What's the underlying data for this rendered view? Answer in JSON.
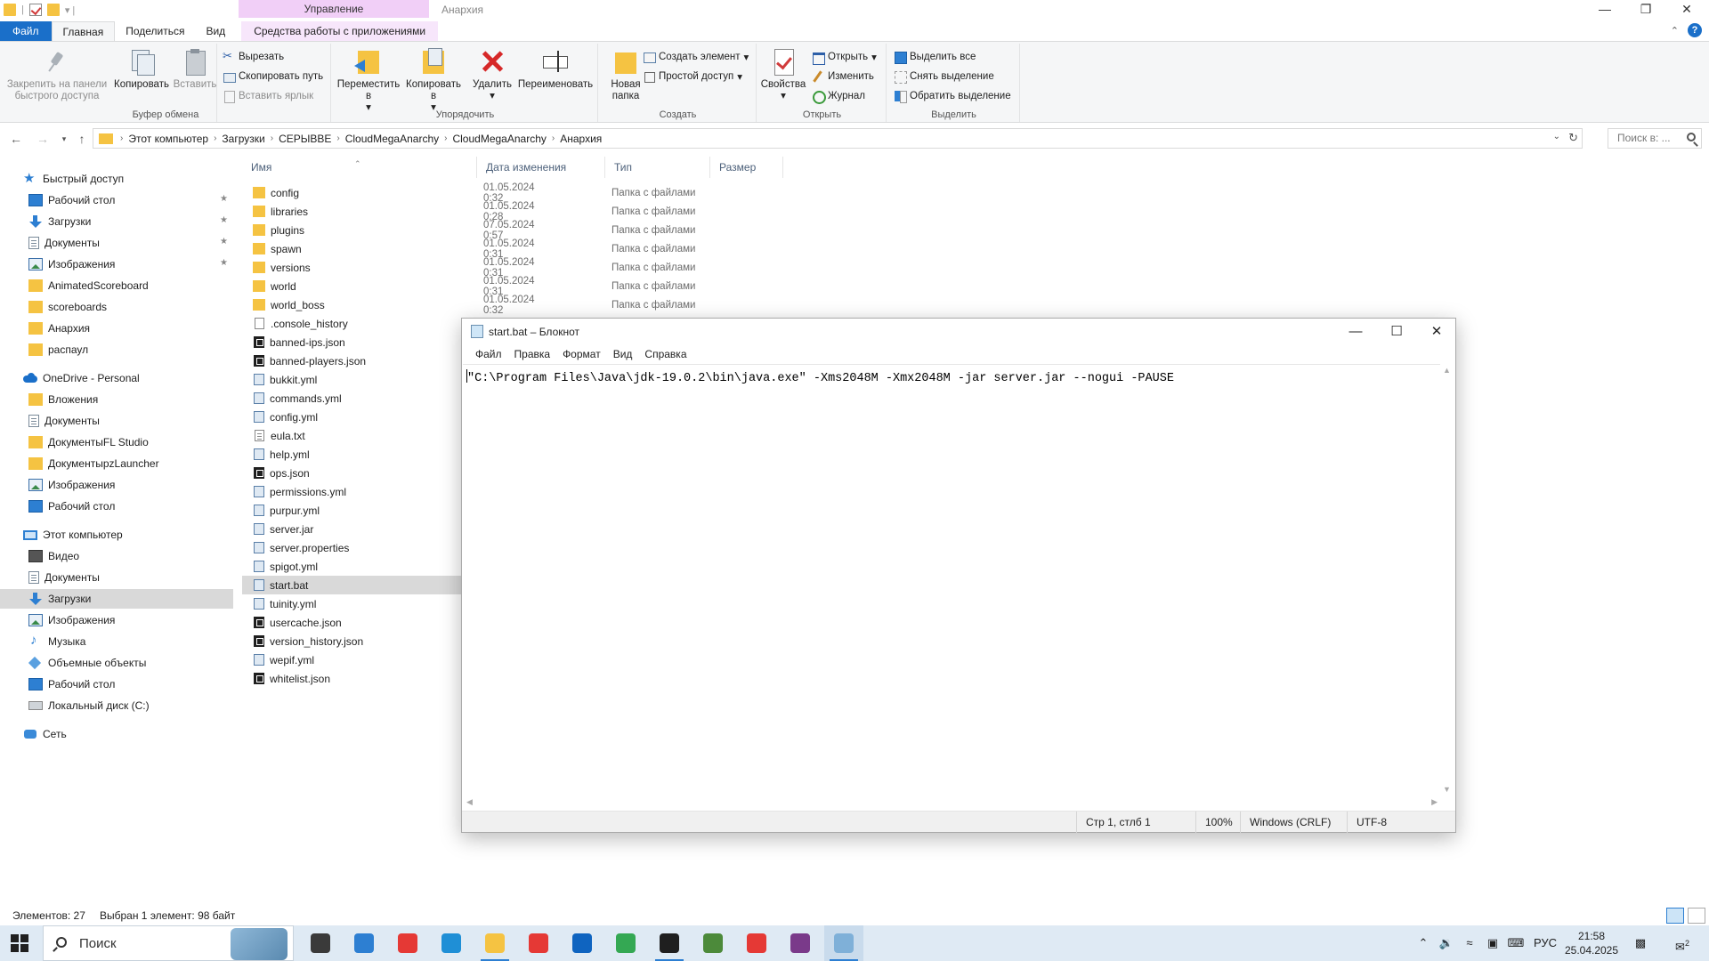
{
  "explorer": {
    "window_title": "Анархия",
    "manage_tab": "Управление",
    "tabs": [
      "Файл",
      "Главная",
      "Поделиться",
      "Вид"
    ],
    "apptools_tab": "Средства работы с приложениями",
    "ribbon": {
      "clipboard": {
        "label": "Буфер обмена",
        "pin": "Закрепить на панели быстрого доступа",
        "copy": "Копировать",
        "paste": "Вставить",
        "cut": "Вырезать",
        "copy_path": "Скопировать путь",
        "paste_shortcut": "Вставить ярлык"
      },
      "organize": {
        "label": "Упорядочить",
        "move_to": "Переместить в",
        "copy_to": "Копировать в",
        "delete": "Удалить",
        "rename": "Переименовать"
      },
      "create": {
        "label": "Создать",
        "new_folder": "Новая папка",
        "new_item": "Создать элемент",
        "easy_access": "Простой доступ"
      },
      "open": {
        "label": "Открыть",
        "properties": "Свойства",
        "open": "Открыть",
        "edit": "Изменить",
        "history": "Журнал"
      },
      "select": {
        "label": "Выделить",
        "select_all": "Выделить все",
        "select_none": "Снять выделение",
        "invert": "Обратить выделение"
      }
    },
    "breadcrumb": [
      "Этот компьютер",
      "Загрузки",
      "СЕРЫВВЕ",
      "CloudMegaAnarchy",
      "CloudMegaAnarchy",
      "Анархия"
    ],
    "search_placeholder": "Поиск в: ...",
    "nav": [
      {
        "label": "Быстрый доступ",
        "icon": "star",
        "level": 0
      },
      {
        "label": "Рабочий стол",
        "icon": "desktop",
        "level": 1,
        "pinned": true
      },
      {
        "label": "Загрузки",
        "icon": "download",
        "level": 1,
        "pinned": true
      },
      {
        "label": "Документы",
        "icon": "documents",
        "level": 1,
        "pinned": true
      },
      {
        "label": "Изображения",
        "icon": "pictures",
        "level": 1,
        "pinned": true
      },
      {
        "label": "AnimatedScoreboard",
        "icon": "folder",
        "level": 1
      },
      {
        "label": "scoreboards",
        "icon": "folder",
        "level": 1
      },
      {
        "label": "Анархия",
        "icon": "folder",
        "level": 1
      },
      {
        "label": "распаул",
        "icon": "folder",
        "level": 1
      },
      {
        "label": "OneDrive - Personal",
        "icon": "cloud",
        "level": 0,
        "gap": true
      },
      {
        "label": "Вложения",
        "icon": "folder",
        "level": 1
      },
      {
        "label": "Документы",
        "icon": "documents",
        "level": 1
      },
      {
        "label": "ДокументыFL Studio",
        "icon": "folder",
        "level": 1
      },
      {
        "label": "ДокументыpzLauncher",
        "icon": "folder",
        "level": 1
      },
      {
        "label": "Изображения",
        "icon": "pictures",
        "level": 1
      },
      {
        "label": "Рабочий стол",
        "icon": "desktop",
        "level": 1
      },
      {
        "label": "Этот компьютер",
        "icon": "pc",
        "level": 0,
        "gap": true
      },
      {
        "label": "Видео",
        "icon": "video",
        "level": 1
      },
      {
        "label": "Документы",
        "icon": "documents",
        "level": 1
      },
      {
        "label": "Загрузки",
        "icon": "download",
        "level": 1,
        "selected": true
      },
      {
        "label": "Изображения",
        "icon": "pictures",
        "level": 1
      },
      {
        "label": "Музыка",
        "icon": "music",
        "level": 1
      },
      {
        "label": "Объемные объекты",
        "icon": "3d",
        "level": 1
      },
      {
        "label": "Рабочий стол",
        "icon": "desktop",
        "level": 1
      },
      {
        "label": "Локальный диск (C:)",
        "icon": "disk",
        "level": 1
      },
      {
        "label": "Сеть",
        "icon": "network",
        "level": 0,
        "gap": true
      }
    ],
    "columns": [
      "Имя",
      "Дата изменения",
      "Тип",
      "Размер"
    ],
    "files": [
      {
        "name": "config",
        "kind": "folder",
        "date": "01.05.2024 0:32",
        "type": "Папка с файлами"
      },
      {
        "name": "libraries",
        "kind": "folder",
        "date": "01.05.2024 0:28",
        "type": "Папка с файлами"
      },
      {
        "name": "plugins",
        "kind": "folder",
        "date": "07.05.2024 0:57",
        "type": "Папка с файлами"
      },
      {
        "name": "spawn",
        "kind": "folder",
        "date": "01.05.2024 0:31",
        "type": "Папка с файлами"
      },
      {
        "name": "versions",
        "kind": "folder",
        "date": "01.05.2024 0:31",
        "type": "Папка с файлами"
      },
      {
        "name": "world",
        "kind": "folder",
        "date": "01.05.2024 0:31",
        "type": "Папка с файлами"
      },
      {
        "name": "world_boss",
        "kind": "folder",
        "date": "01.05.2024 0:32",
        "type": "Папка с файлами"
      },
      {
        "name": ".console_history",
        "kind": "file"
      },
      {
        "name": "banned-ips.json",
        "kind": "json"
      },
      {
        "name": "banned-players.json",
        "kind": "json"
      },
      {
        "name": "bukkit.yml",
        "kind": "yml"
      },
      {
        "name": "commands.yml",
        "kind": "yml"
      },
      {
        "name": "config.yml",
        "kind": "yml"
      },
      {
        "name": "eula.txt",
        "kind": "txt"
      },
      {
        "name": "help.yml",
        "kind": "yml"
      },
      {
        "name": "ops.json",
        "kind": "json"
      },
      {
        "name": "permissions.yml",
        "kind": "yml"
      },
      {
        "name": "purpur.yml",
        "kind": "yml"
      },
      {
        "name": "server.jar",
        "kind": "yml"
      },
      {
        "name": "server.properties",
        "kind": "yml"
      },
      {
        "name": "spigot.yml",
        "kind": "yml"
      },
      {
        "name": "start.bat",
        "kind": "yml",
        "selected": true
      },
      {
        "name": "tuinity.yml",
        "kind": "yml"
      },
      {
        "name": "usercache.json",
        "kind": "json"
      },
      {
        "name": "version_history.json",
        "kind": "json"
      },
      {
        "name": "wepif.yml",
        "kind": "yml"
      },
      {
        "name": "whitelist.json",
        "kind": "json"
      }
    ],
    "status": {
      "count": "Элементов: 27",
      "selection": "Выбран 1 элемент: 98 байт"
    }
  },
  "notepad": {
    "title": "start.bat – Блокнот",
    "menu": [
      "Файл",
      "Правка",
      "Формат",
      "Вид",
      "Справка"
    ],
    "content": "\"C:\\Program Files\\Java\\jdk-19.0.2\\bin\\java.exe\" -Xms2048M -Xmx2048M -jar server.jar --nogui -PAUSE",
    "status": {
      "position": "Стр 1, стлб 1",
      "zoom": "100%",
      "eol": "Windows (CRLF)",
      "encoding": "UTF-8"
    }
  },
  "taskbar": {
    "search_text": "Поиск",
    "lang": "РУС",
    "time": "21:58",
    "date": "25.04.2025",
    "notification_count": "2",
    "apps": [
      {
        "name": "task-view",
        "color": "#3a3a3a"
      },
      {
        "name": "app-window",
        "color": "#2d7fd2"
      },
      {
        "name": "yandex-browser",
        "color": "#e53935"
      },
      {
        "name": "edge",
        "color": "#1f8fd6"
      },
      {
        "name": "file-explorer",
        "color": "#f5c342",
        "running": true
      },
      {
        "name": "yandex",
        "color": "#e53935"
      },
      {
        "name": "outlook",
        "color": "#0f64c0"
      },
      {
        "name": "chrome",
        "color": "#34a853"
      },
      {
        "name": "terminal",
        "color": "#1f1f1f",
        "running": true
      },
      {
        "name": "minecraft",
        "color": "#4c8a3a"
      },
      {
        "name": "yandex-2",
        "color": "#e53935"
      },
      {
        "name": "winrar",
        "color": "#7a3a8a"
      },
      {
        "name": "notepad",
        "color": "#7fb0d8",
        "running": true,
        "active": true
      }
    ]
  }
}
